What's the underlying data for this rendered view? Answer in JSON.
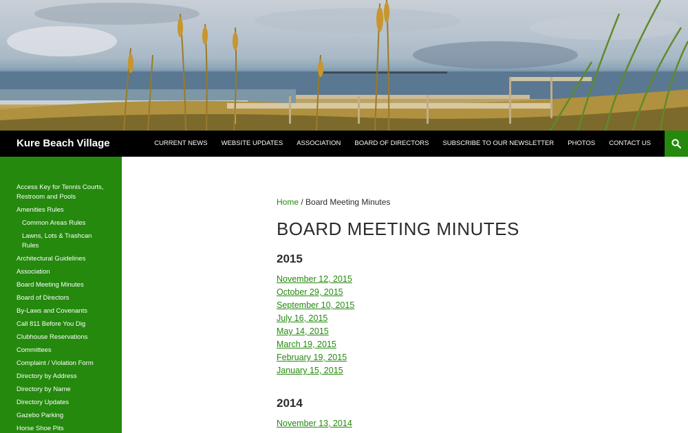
{
  "site": {
    "title": "Kure Beach Village"
  },
  "colors": {
    "accent_green": "#24890d",
    "nav_background": "#000000",
    "text": "#2b2b2b"
  },
  "nav": {
    "items": [
      "CURRENT NEWS",
      "WEBSITE UPDATES",
      "ASSOCIATION",
      "BOARD OF DIRECTORS",
      "SUBSCRIBE TO OUR NEWSLETTER",
      "PHOTOS",
      "CONTACT US"
    ],
    "search_icon": "search-icon"
  },
  "sidebar": {
    "items": [
      {
        "label": "Access Key for Tennis Courts, Restroom and Pools",
        "sub": false
      },
      {
        "label": "Amenities Rules",
        "sub": false
      },
      {
        "label": "Common Areas Rules",
        "sub": true
      },
      {
        "label": "Lawns, Lots & Trashcan Rules",
        "sub": true
      },
      {
        "label": "Architectural Guidelines",
        "sub": false
      },
      {
        "label": "Association",
        "sub": false
      },
      {
        "label": "Board Meeting Minutes",
        "sub": false
      },
      {
        "label": "Board of Directors",
        "sub": false
      },
      {
        "label": "By-Laws and Covenants",
        "sub": false
      },
      {
        "label": "Call 811 Before You Dig",
        "sub": false
      },
      {
        "label": "Clubhouse Reservations",
        "sub": false
      },
      {
        "label": "Committees",
        "sub": false
      },
      {
        "label": "Complaint / Violation Form",
        "sub": false
      },
      {
        "label": "Directory by Address",
        "sub": false
      },
      {
        "label": "Directory by Name",
        "sub": false
      },
      {
        "label": "Directory Updates",
        "sub": false
      },
      {
        "label": "Gazebo Parking",
        "sub": false
      },
      {
        "label": "Horse Shoe Pits",
        "sub": false
      }
    ]
  },
  "breadcrumb": {
    "home": "Home",
    "separator": " / ",
    "current": "Board Meeting Minutes"
  },
  "page": {
    "title": "BOARD MEETING MINUTES"
  },
  "years": [
    {
      "year": "2015",
      "links": [
        "November 12, 2015",
        "October 29, 2015",
        "September 10, 2015",
        "July 16, 2015",
        "May 14, 2015",
        "March 19, 2015",
        "February 19, 2015",
        "January 15, 2015"
      ]
    },
    {
      "year": "2014",
      "links": [
        "November 13, 2014"
      ]
    }
  ]
}
